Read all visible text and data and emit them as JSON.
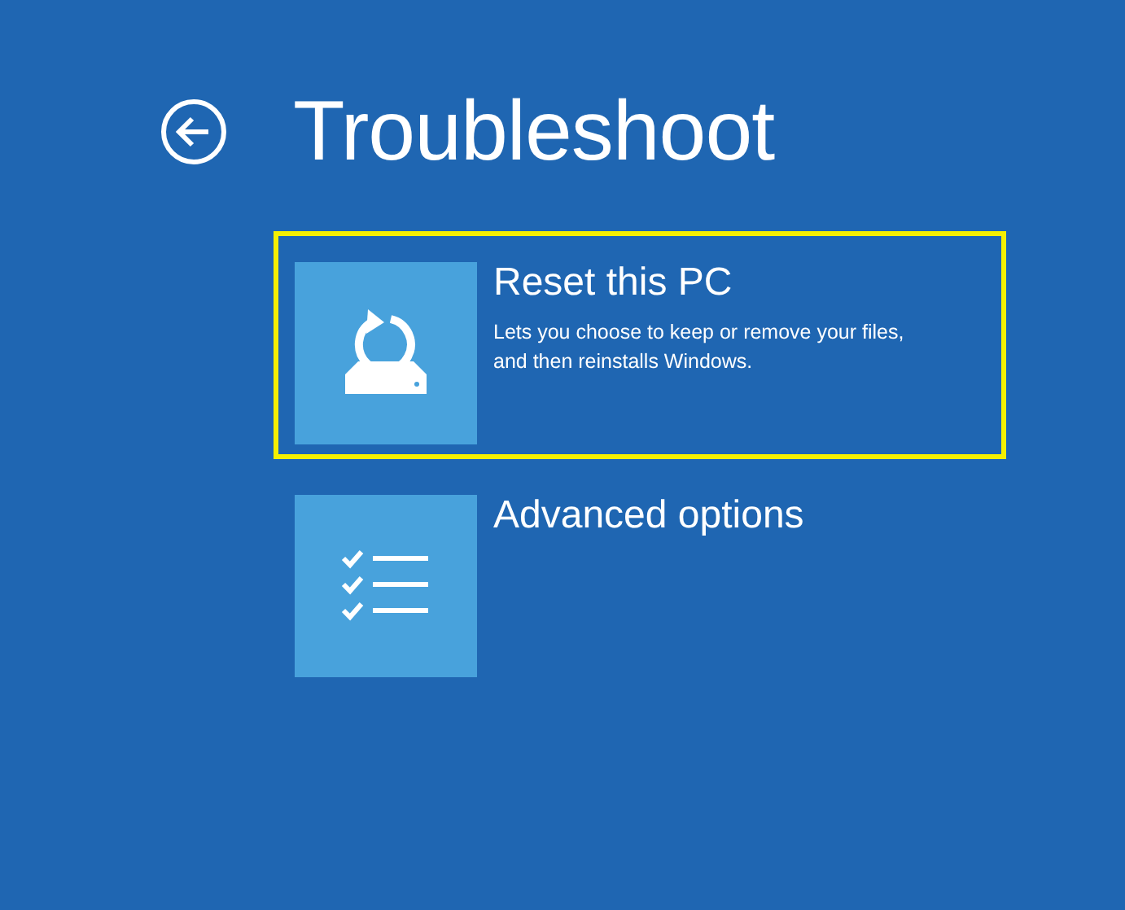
{
  "header": {
    "title": "Troubleshoot"
  },
  "options": [
    {
      "kind": "reset",
      "title": "Reset this PC",
      "description": "Lets you choose to keep or remove your files, and then reinstalls Windows.",
      "selected": true
    },
    {
      "kind": "advanced",
      "title": "Advanced options",
      "selected": false
    }
  ]
}
